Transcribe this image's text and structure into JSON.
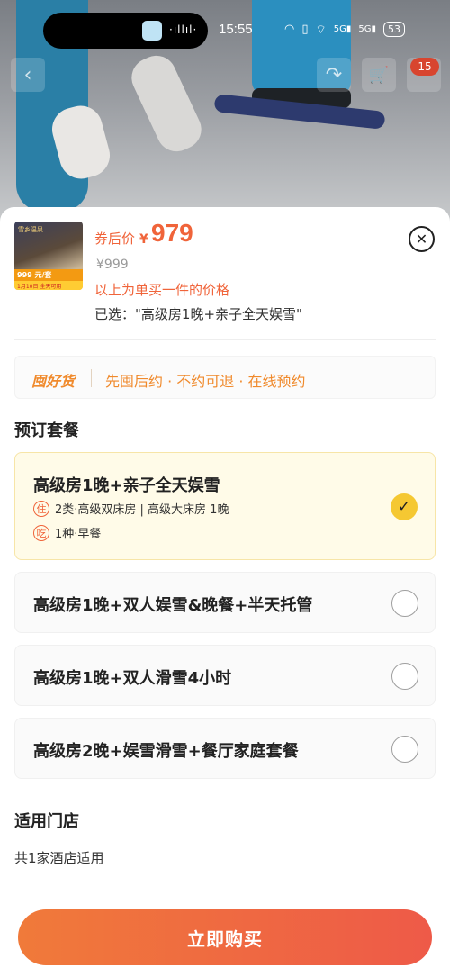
{
  "status_bar": {
    "time": "15:55",
    "wave": "·ıllıl·",
    "sys_icons": [
      "headphones-icon",
      "vibrate-icon",
      "wifi-icon",
      "5g-signal-icon",
      "5g-signal-icon"
    ],
    "sys_glyphs": [
      "◠",
      "▯",
      "⌔",
      "5G▮",
      "5G▮"
    ],
    "battery": "53"
  },
  "nav": {
    "back_glyph": "‹",
    "share_glyph": "↷",
    "cart_glyph": "🛒",
    "badge_count": "15"
  },
  "product": {
    "thumb_text_top": "雪乡温泉",
    "thumb_price": "999 元/套",
    "thumb_sub": "1月10日 全天可用",
    "price_label": "券后价",
    "currency": "¥",
    "price": "979",
    "original_price": "¥999",
    "unit_note": "以上为单买一件的价格",
    "selected": "已选：\"高级房1晚+亲子全天娱雪\""
  },
  "guarantee": {
    "brand": "囤好货",
    "text": "先囤后约 · 不约可退 · 在线预约"
  },
  "packages_title": "预订套餐",
  "packages": [
    {
      "name": "高级房1晚+亲子全天娱雪",
      "selected": true,
      "details": [
        {
          "tag": "住",
          "text": "2类·高级双床房 | 高级大床房 1晚"
        },
        {
          "tag": "吃",
          "text": "1种·早餐"
        }
      ]
    },
    {
      "name": "高级房1晚+双人娱雪&晚餐+半天托管",
      "selected": false
    },
    {
      "name": "高级房1晚+双人滑雪4小时",
      "selected": false
    },
    {
      "name": "高级房2晚+娱雪滑雪+餐厅家庭套餐",
      "selected": false
    }
  ],
  "stores": {
    "title": "适用门店",
    "count_text": "共1家酒店适用"
  },
  "buy_button": "立即购买",
  "close_glyph": "✕",
  "check_glyph": "✓",
  "colors": {
    "accent": "#f0643a",
    "guarantee": "#f08a2c",
    "check_yellow": "#f5c832",
    "selected_bg": "#fffbe8"
  }
}
